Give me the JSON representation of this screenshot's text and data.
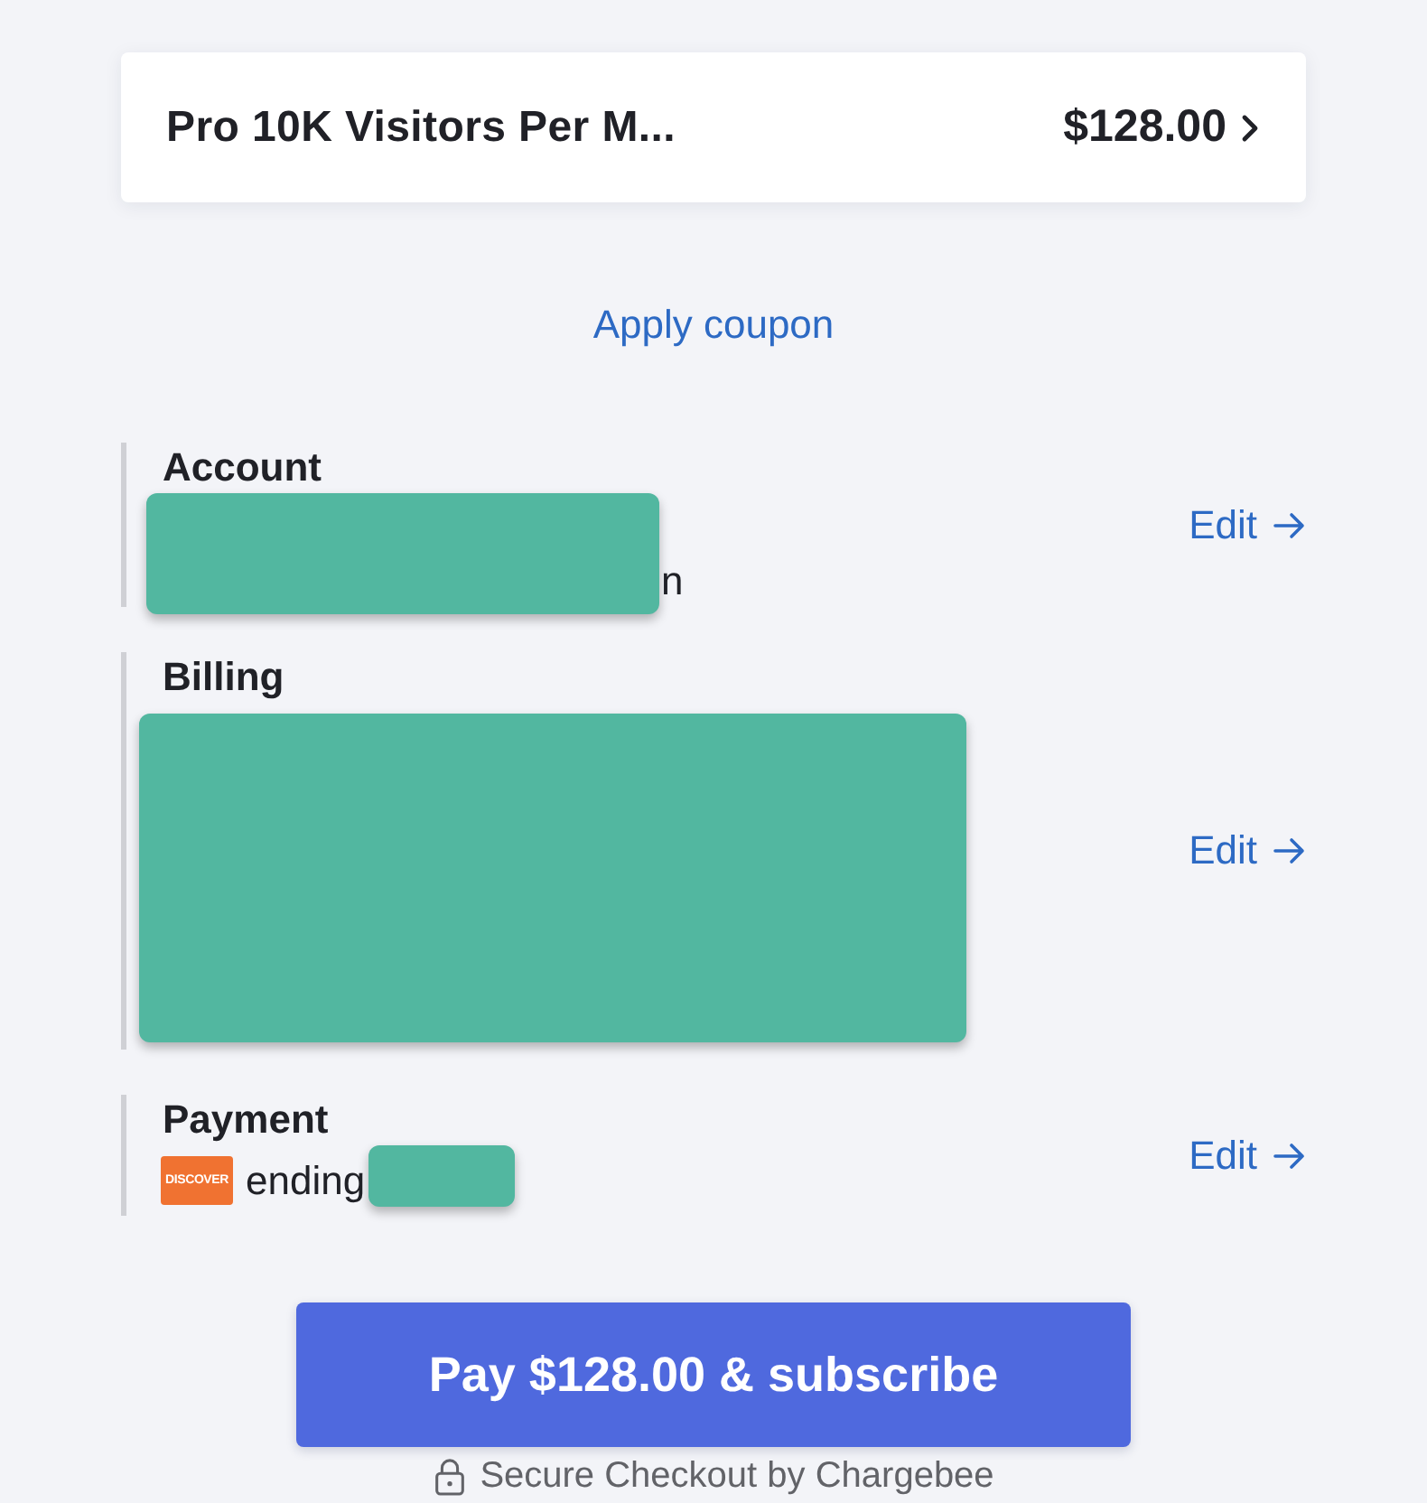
{
  "plan": {
    "name": "Pro 10K Visitors Per M...",
    "price": "$128.00"
  },
  "coupon_link": "Apply coupon",
  "sections": [
    {
      "kind": "account",
      "title": "Account",
      "redacted": true,
      "detail_tail": "n",
      "action": "Edit"
    },
    {
      "kind": "billing",
      "title": "Billing",
      "redacted": true,
      "action": "Edit"
    },
    {
      "kind": "payment",
      "title": "Payment",
      "card_brand": "DISCOVER",
      "detail": "ending",
      "redacted": true,
      "action": "Edit"
    }
  ],
  "pay_button": "Pay $128.00 & subscribe",
  "footer": "Secure Checkout by Chargebee"
}
